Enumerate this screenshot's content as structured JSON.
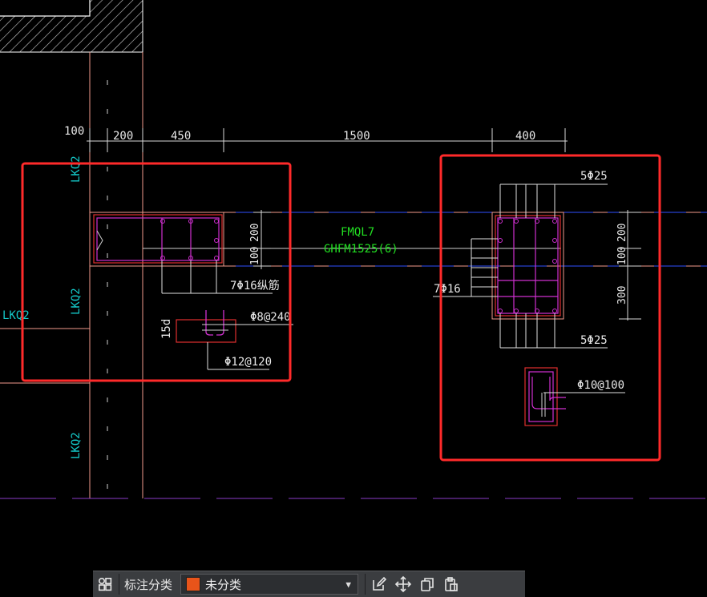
{
  "colors": {
    "background": "#000000",
    "wall_line": "#f29a8c",
    "dim_line": "#d8d8d8",
    "axis_line": "#3050ff",
    "grid_label": "#14c8c8",
    "beam_text": "#22e022",
    "stirrup": "#d030d0",
    "section_outline": "#e03030",
    "highlight_box": "#ff2a2a",
    "toolbar_swatch": "#e8541a"
  },
  "dimensions": {
    "d100_left": "100",
    "d200": "200",
    "d450": "450",
    "d1500": "1500",
    "d400": "400",
    "v200_left": "200",
    "v100_left": "100",
    "v200_right": "200",
    "v100_right": "100",
    "v300_right": "300"
  },
  "grid_labels": {
    "lkq2_top": "LKQ2",
    "lkq2_mid": "LKQ2",
    "lkq2_side": "LKQ2",
    "lkq2_bottom": "LKQ2"
  },
  "beam": {
    "name": "FMQL7",
    "spec": "GHFM1525(6)"
  },
  "left_section": {
    "long_bars": "7Φ16纵筋",
    "tie": "Φ8@240",
    "hook": "15d",
    "stirrup": "Φ12@120"
  },
  "right_section": {
    "top_bars": "5Φ25",
    "side_bars": "7Φ16",
    "bottom_bars": "5Φ25",
    "stirrup": "Φ10@100"
  },
  "toolbar": {
    "icons": [
      "layout-icon",
      "edit-icon",
      "move-icon",
      "copy-icon",
      "paste-icon"
    ],
    "label": "标注分类",
    "category_value": "未分类"
  }
}
